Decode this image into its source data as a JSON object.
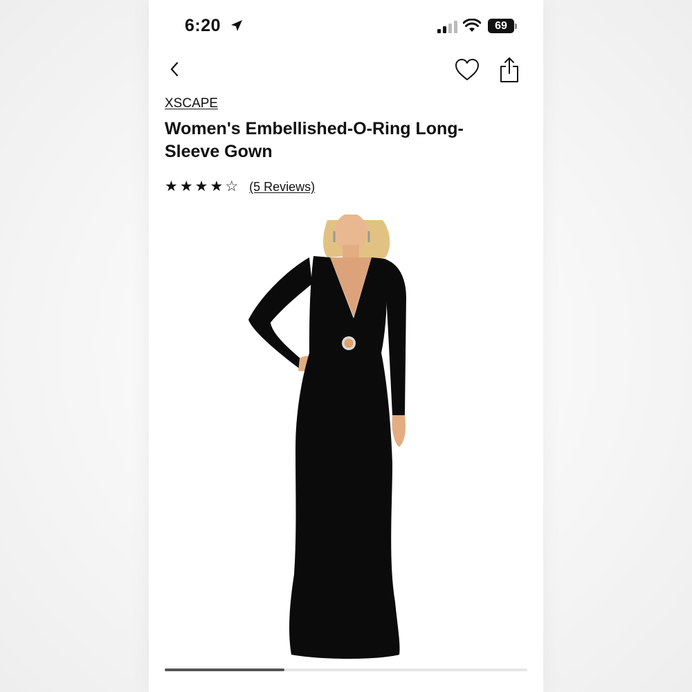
{
  "status_bar": {
    "time": "6:20",
    "battery": "69",
    "icons": [
      "location-arrow-icon",
      "signal-icon",
      "wifi-icon",
      "battery-icon"
    ]
  },
  "nav": {
    "icons": [
      "chevron-left-icon",
      "heart-icon",
      "share-icon"
    ]
  },
  "product": {
    "brand": "XSCAPE",
    "title": "Women's Embellished-O-Ring Long-Sleeve Gown",
    "rating": 4,
    "rating_max": 5,
    "reviews_label": "(5 Reviews)",
    "image_alt": "Black long-sleeve gown with O-ring"
  },
  "carousel": {
    "progress": 0.33
  },
  "colors": {
    "text": "#111111",
    "gown": "#0b0b0b",
    "skin": "#e8b48a",
    "hair": "#e0c182"
  }
}
